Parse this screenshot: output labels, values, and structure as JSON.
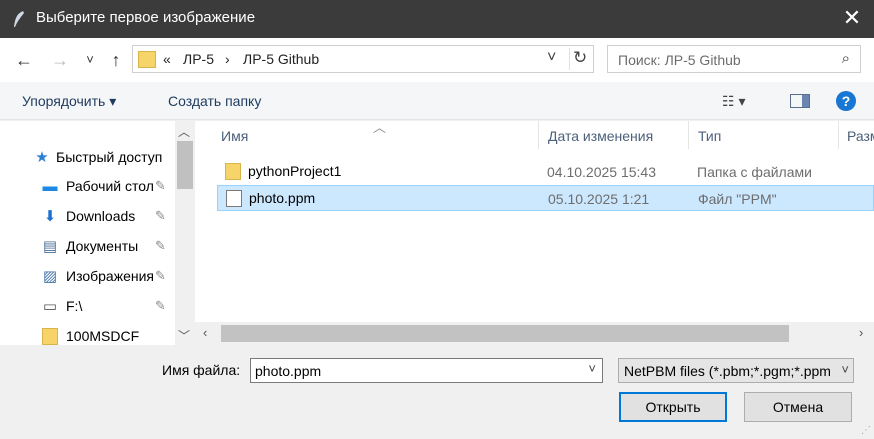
{
  "window": {
    "title": "Выберите первое изображение",
    "close_label": "✕"
  },
  "nav": {
    "back": "←",
    "forward": "→",
    "recent": "˅",
    "up": "↑",
    "path": [
      "ЛР-5",
      "ЛР-5 Github"
    ],
    "path_prefix": "«",
    "path_sep": "›",
    "dropdown": "˅",
    "refresh": "↻"
  },
  "search": {
    "placeholder": "Поиск: ЛР-5 Github",
    "icon": "search-icon"
  },
  "toolbar": {
    "organize": "Упорядочить ▾",
    "new_folder": "Создать папку",
    "view": "☷ ▾",
    "help": "?"
  },
  "sidebar": {
    "items": [
      {
        "label": "Быстрый доступ",
        "icon": "star-icon",
        "glyph": "★",
        "pinned": false
      },
      {
        "label": "Рабочий стол",
        "icon": "desktop-icon",
        "glyph": "▬",
        "pinned": true
      },
      {
        "label": "Downloads",
        "icon": "download-icon",
        "glyph": "⬇",
        "pinned": true
      },
      {
        "label": "Документы",
        "icon": "document-icon",
        "glyph": "▤",
        "pinned": true
      },
      {
        "label": "Изображения",
        "icon": "pictures-icon",
        "glyph": "▨",
        "pinned": true
      },
      {
        "label": "F:\\",
        "icon": "drive-icon",
        "glyph": "▭",
        "pinned": true
      },
      {
        "label": "100MSDCF",
        "icon": "folder-icon",
        "glyph": "",
        "pinned": false
      }
    ],
    "pin_glyph": "📌"
  },
  "files": {
    "columns": [
      "Имя",
      "Дата изменения",
      "Тип",
      "Разм"
    ],
    "rows": [
      {
        "name": "pythonProject1",
        "date": "04.10.2025 15:43",
        "type": "Папка с файлами",
        "kind": "folder",
        "selected": false
      },
      {
        "name": "photo.ppm",
        "date": "05.10.2025 1:21",
        "type": "Файл \"PPM\"",
        "kind": "file",
        "selected": true
      }
    ]
  },
  "footer": {
    "filename_label": "Имя файла:",
    "filename_value": "photo.ppm",
    "filter_value": "NetPBM files (*.pbm;*.pgm;*.ppm)",
    "open_label": "Открыть",
    "cancel_label": "Отмена"
  },
  "colors": {
    "titlebar": "#3b3b3b",
    "selection": "#cce8ff",
    "accent": "#0078d7",
    "help": "#1976d2"
  }
}
